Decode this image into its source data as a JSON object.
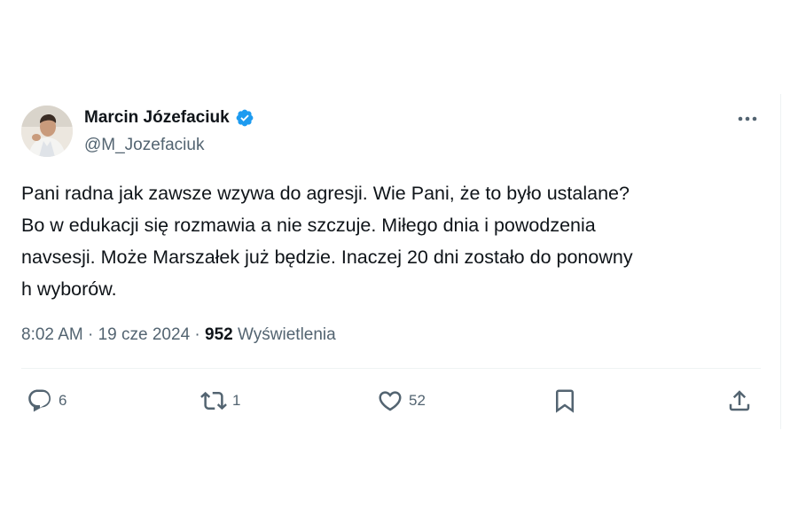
{
  "author": {
    "name": "Marcin Józefaciuk",
    "handle": "@M_Jozefaciuk",
    "verified_icon": "verified-badge-icon",
    "verified_color": "#1d9bf0"
  },
  "tweet": {
    "text": "Pani radna jak zawsze wzywa do agresji. Wie Pani, że to było ustalane?\nBo w edukacji się rozmawia a nie szczuje. Miłego dnia i powodzenia\nnavsesji. Może Marszałek już będzie. Inaczej 20 dni zostało do ponowny\nh wyborów."
  },
  "meta": {
    "time": "8:02 AM",
    "separator": " · ",
    "date": "19 cze 2024",
    "views_count": "952",
    "views_label": "Wyświetlenia"
  },
  "actions": {
    "reply_count": "6",
    "retweet_count": "1",
    "like_count": "52"
  },
  "icons": {
    "more": "more-dots-icon",
    "reply": "reply-bubble-icon",
    "retweet": "retweet-icon",
    "like": "heart-icon",
    "bookmark": "bookmark-icon",
    "share": "share-upload-icon"
  }
}
